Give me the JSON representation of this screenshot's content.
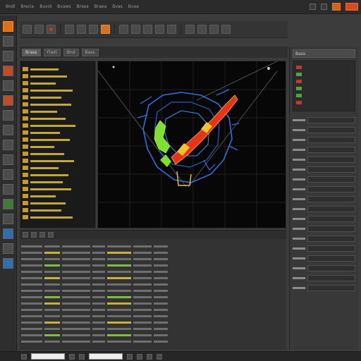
{
  "menubar": {
    "items": [
      "Bndl",
      "Brecia",
      "Buvid",
      "Bvaws",
      "Brsea",
      "Braea",
      "Bvas",
      "Bvaa"
    ]
  },
  "tabs": [
    "Brass",
    "Flast",
    "Bnd",
    "Bass"
  ],
  "right_panel": {
    "header": "Bass"
  },
  "colors": {
    "accent": "#e07018",
    "close": "#d84a23",
    "wireframe_blue": "#2f6fe0",
    "wireframe_green": "#7ee02c",
    "wireframe_red": "#e8321e",
    "wireframe_yellow": "#f2c230"
  },
  "icons": [
    "app-logo-icon",
    "select-icon",
    "move-icon",
    "rotate-icon",
    "scale-icon",
    "render-icon",
    "camera-icon",
    "light-icon"
  ]
}
